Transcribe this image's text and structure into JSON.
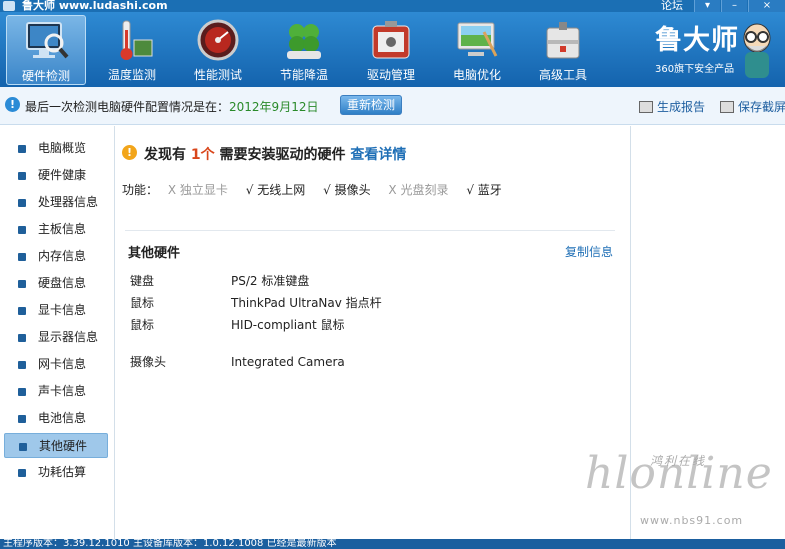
{
  "titlebar": {
    "title": "鲁大师 www.ludashi.com",
    "forum": "论坛",
    "buttons": [
      "▾",
      "–",
      "×"
    ]
  },
  "toolbar": {
    "items": [
      {
        "label": "硬件检测",
        "icon": "monitor-magnifier-icon",
        "active": true
      },
      {
        "label": "温度监测",
        "icon": "thermometer-icon",
        "active": false
      },
      {
        "label": "性能测试",
        "icon": "speedometer-icon",
        "active": false
      },
      {
        "label": "节能降温",
        "icon": "clover-icon",
        "active": false
      },
      {
        "label": "驱动管理",
        "icon": "toolbox-icon",
        "active": false
      },
      {
        "label": "电脑优化",
        "icon": "screen-broom-icon",
        "active": false
      },
      {
        "label": "高级工具",
        "icon": "toolkit-icon",
        "active": false
      }
    ],
    "brand": {
      "logo": "鲁大师",
      "tagline": "360旗下安全产品"
    }
  },
  "infobar": {
    "text": "最后一次检测电脑硬件配置情况是在：",
    "date": "2012年9月12日",
    "recheck": "重新检测",
    "report": "生成报告",
    "screenshot": "保存截屏"
  },
  "sidebar": {
    "items": [
      "电脑概览",
      "硬件健康",
      "处理器信息",
      "主板信息",
      "内存信息",
      "硬盘信息",
      "显卡信息",
      "显示器信息",
      "网卡信息",
      "声卡信息",
      "电池信息",
      "其他硬件",
      "功耗估算"
    ],
    "active": "其他硬件"
  },
  "main": {
    "headline": {
      "prefix": "发现有 ",
      "count": "1个",
      "middle": " 需要安装驱动的硬件 ",
      "link": "查看详情"
    },
    "features_label": "功能：",
    "features": [
      {
        "mark": "X",
        "name": "独立显卡",
        "enabled": false
      },
      {
        "mark": "√",
        "name": "无线上网",
        "enabled": true
      },
      {
        "mark": "√",
        "name": "摄像头",
        "enabled": true
      },
      {
        "mark": "X",
        "name": "光盘刻录",
        "enabled": false
      },
      {
        "mark": "√",
        "name": "蓝牙",
        "enabled": true
      }
    ],
    "section_title": "其他硬件",
    "copy_link": "复制信息",
    "hardware": [
      {
        "key": "键盘",
        "value": "PS/2 标准键盘"
      },
      {
        "key": "鼠标",
        "value": "ThinkPad UltraNav 指点杆"
      },
      {
        "key": "鼠标",
        "value": "HID-compliant 鼠标"
      },
      {
        "key": "摄像头",
        "value": "Integrated Camera"
      }
    ]
  },
  "watermark": {
    "script": "hlonline",
    "chinese": "鸿利在线",
    "url": "www.nbs91.com"
  },
  "statusbar": {
    "text": "主程序版本：3.39.12.1010    主设备库版本：1.0.12.1008    已经是最新版本"
  }
}
